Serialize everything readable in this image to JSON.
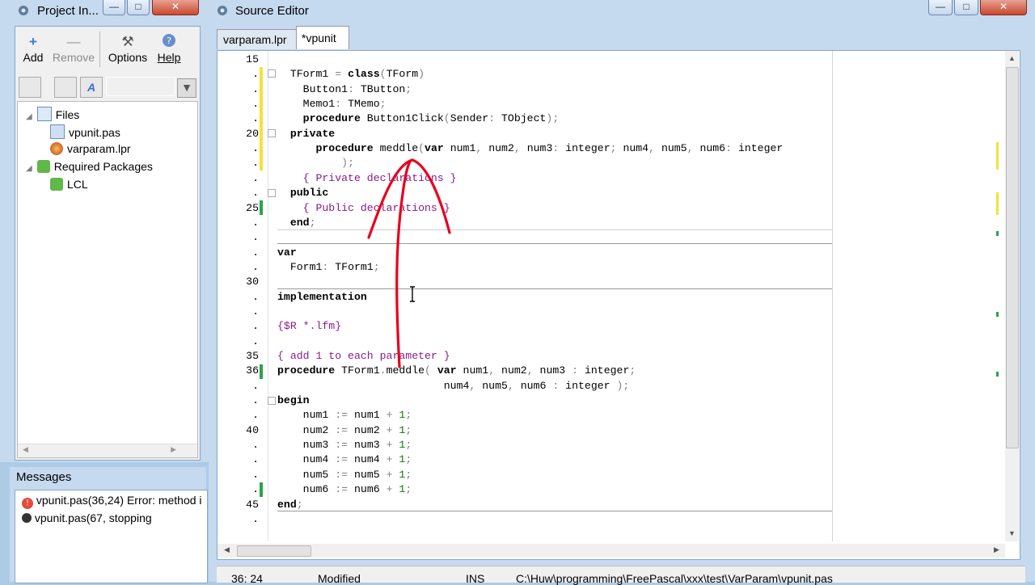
{
  "project_window": {
    "title": "Project In...",
    "toolbar": [
      {
        "label": "Add",
        "icon": "plus-icon"
      },
      {
        "label": "Remove",
        "icon": "minus-icon"
      },
      {
        "label": "Options",
        "icon": "tools-icon"
      },
      {
        "label": "Help",
        "icon": "help-icon"
      }
    ],
    "filter_placeholder": "",
    "tree": [
      {
        "label": "Files",
        "icon": "files-icon"
      },
      {
        "label": "vpunit.pas",
        "icon": "pas-file-icon"
      },
      {
        "label": "varparam.lpr",
        "icon": "lpr-file-icon"
      },
      {
        "label": "Required Packages",
        "icon": "package-icon"
      },
      {
        "label": "LCL",
        "icon": "package-icon"
      }
    ]
  },
  "messages": {
    "title": "Messages",
    "items": [
      {
        "text": "vpunit.pas(36,24) Error: method i",
        "icon": "error-icon"
      },
      {
        "text": "vpunit.pas(67, stopping",
        "icon": "bomb-icon"
      }
    ]
  },
  "editor": {
    "title": "Source Editor",
    "tabs": [
      {
        "label": "varparam.lpr",
        "active": false
      },
      {
        "label": "*vpunit",
        "active": true
      }
    ],
    "line_numbers": [
      "15",
      ".",
      ".",
      ".",
      ".",
      "20",
      ".",
      ".",
      ".",
      ".",
      "25",
      ".",
      ".",
      ".",
      ".",
      "30",
      ".",
      ".",
      ".",
      ".",
      "35",
      "36",
      ".",
      ".",
      ".",
      "40",
      ".",
      ".",
      ".",
      ".",
      "45",
      "."
    ],
    "code": [
      "",
      "  TForm1 = class(TForm)",
      "    Button1: TButton;",
      "    Memo1: TMemo;",
      "    procedure Button1Click(Sender: TObject);",
      "  private",
      "      procedure meddle(var num1, num2, num3: integer; num4, num5, num6: integer",
      "          );",
      "    { Private declarations }",
      "  public",
      "    { Public declarations }",
      "  end;",
      "",
      "var",
      "  Form1: TForm1;",
      "",
      "implementation",
      "",
      "{$R *.lfm}",
      "",
      "{ add 1 to each parameter }",
      "procedure TForm1.meddle( var num1, num2, num3 : integer;",
      "                          num4, num5, num6 : integer );",
      "begin",
      "    num1 := num1 + 1;",
      "    num2 := num2 + 1;",
      "    num3 := num3 + 1;",
      "    num4 := num4 + 1;",
      "    num5 := num5 + 1;",
      "    num6 := num6 + 1;",
      "end;",
      ""
    ]
  },
  "status_bar": {
    "position": "36: 24",
    "state": "Modified",
    "mode": "INS",
    "path": "C:\\Huw\\programming\\FreePascal\\xxx\\test\\VarParam\\vpunit.pas"
  },
  "colors": {
    "annotation": "#e8001c",
    "keyword": "#000000",
    "comment": "#8a1b8a",
    "number": "#008000"
  }
}
